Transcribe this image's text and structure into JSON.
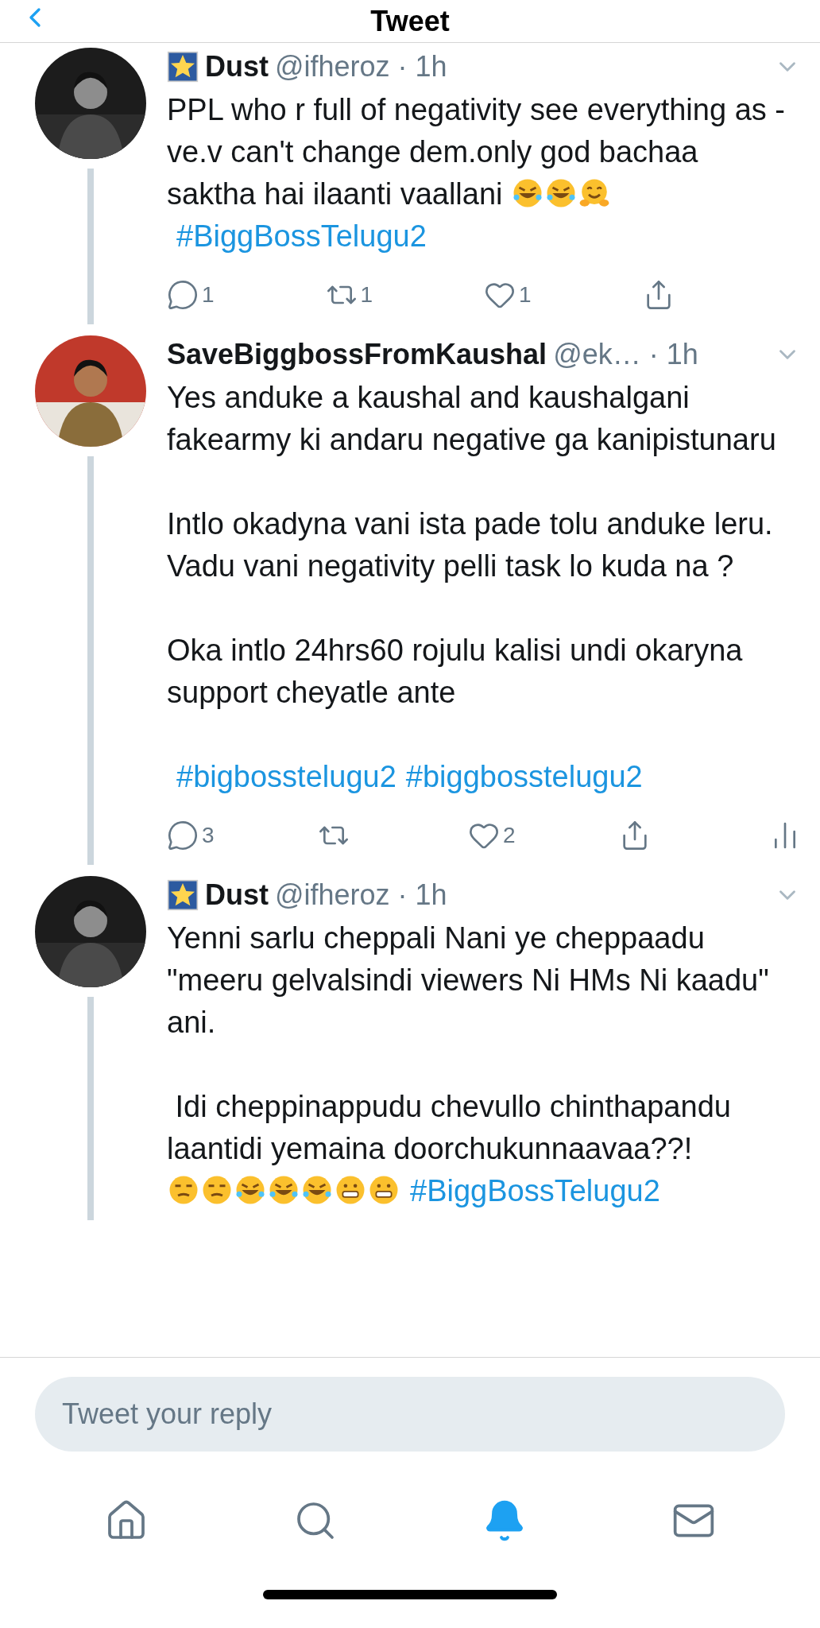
{
  "header": {
    "title": "Tweet"
  },
  "tweets": [
    {
      "avatar": {
        "kind": "mono"
      },
      "name": "Dust",
      "name_badge": true,
      "meta": "@ifheroz · 1h",
      "paragraphs": [
        [
          {
            "kind": "text",
            "text": "PPL who r full of negativity see everything as -ve.v can't change dem.only god bachaa saktha hai ilaanti vaallani "
          },
          {
            "kind": "rofl"
          },
          {
            "kind": "rofl"
          },
          {
            "kind": "hug"
          },
          {
            "kind": "hashtag",
            "text": "#BiggBossTelugu2"
          }
        ]
      ],
      "actions": [
        {
          "kind": "reply",
          "count": "1"
        },
        {
          "kind": "retweet",
          "count": "1"
        },
        {
          "kind": "like",
          "count": "1"
        },
        {
          "kind": "share"
        }
      ]
    },
    {
      "avatar": {
        "kind": "color"
      },
      "name": "SaveBiggbossFromKaushal",
      "name_badge": false,
      "meta": "@ek… · 1h",
      "paragraphs": [
        [
          {
            "kind": "text",
            "text": "Yes anduke a kaushal and kaushalgani fakearmy ki andaru negative ga kanipistunaru"
          }
        ],
        [
          {
            "kind": "text",
            "text": "Intlo okadyna vani ista pade tolu anduke leru. Vadu vani negativity pelli task lo kuda na ?"
          }
        ],
        [
          {
            "kind": "text",
            "text": "Oka intlo 24hrs60 rojulu kalisi undi okaryna support cheyatle ante"
          }
        ],
        [
          {
            "kind": "hashtag",
            "text": "#bigbosstelugu2"
          },
          {
            "kind": "hashtag",
            "text": "#biggbosstelugu2"
          }
        ]
      ],
      "actions": [
        {
          "kind": "reply",
          "count": "3"
        },
        {
          "kind": "retweet"
        },
        {
          "kind": "like",
          "count": "2"
        },
        {
          "kind": "share"
        },
        {
          "kind": "analytics"
        }
      ]
    },
    {
      "avatar": {
        "kind": "mono"
      },
      "name": "Dust",
      "name_badge": true,
      "meta": "@ifheroz · 1h",
      "paragraphs": [
        [
          {
            "kind": "text",
            "text": "Yenni sarlu cheppali Nani ye cheppaadu \"meeru gelvalsindi viewers Ni HMs Ni kaadu\" ani."
          }
        ],
        [
          {
            "kind": "text",
            "text": " Idi cheppinappudu chevullo chinthapandu laantidi yemaina doorchukunnaavaa??!\n"
          },
          {
            "kind": "unamused"
          },
          {
            "kind": "unamused"
          },
          {
            "kind": "rofl"
          },
          {
            "kind": "rofl"
          },
          {
            "kind": "rofl"
          },
          {
            "kind": "grimace"
          },
          {
            "kind": "grimace"
          },
          {
            "kind": "hashtag",
            "text": "#BiggBossTelugu2"
          }
        ]
      ]
    }
  ],
  "reply": {
    "placeholder": "Tweet your reply"
  },
  "tabs": [
    {
      "selected": false
    },
    {
      "selected": false
    },
    {
      "selected": true
    },
    {
      "selected": false
    }
  ]
}
